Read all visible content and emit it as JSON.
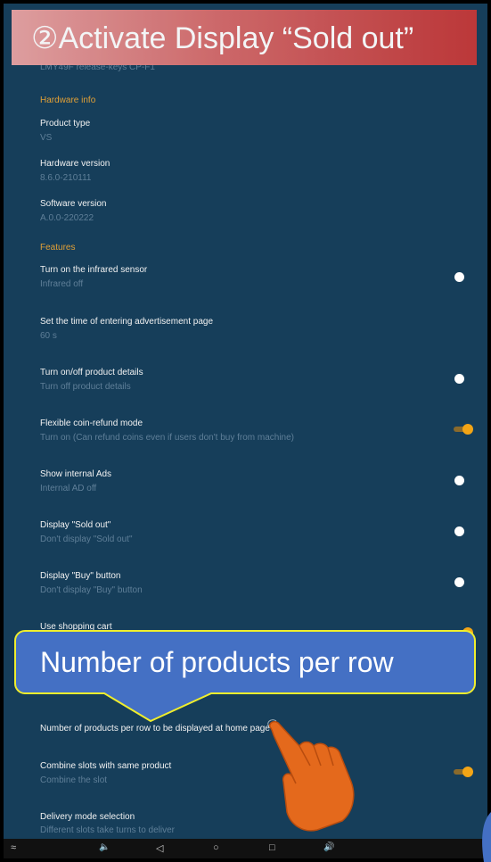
{
  "banner": {
    "title": "②Activate Display “Sold out”"
  },
  "callout": {
    "text": "Number of products per row"
  },
  "settings": {
    "prev_sub": "LMY49F release-keys CP-F1",
    "hardware_section": "Hardware info",
    "product_type": {
      "title": "Product type",
      "value": "VS"
    },
    "hardware_version": {
      "title": "Hardware version",
      "value": "8.6.0-210111"
    },
    "software_version": {
      "title": "Software version",
      "value": "A.0.0-220222"
    },
    "features_section": "Features",
    "items": [
      {
        "title": "Turn on the infrared sensor",
        "sub": "Infrared off",
        "toggle": "off"
      },
      {
        "title": "Set the time of entering advertisement page",
        "sub": "60 s",
        "toggle": "none"
      },
      {
        "title": "Turn on/off product details",
        "sub": "Turn off product details",
        "toggle": "off"
      },
      {
        "title": "Flexible coin-refund mode",
        "sub": "Turn on (Can refund coins even if users don't buy from machine)",
        "toggle": "on"
      },
      {
        "title": "Show internal Ads",
        "sub": "Internal AD off",
        "toggle": "off"
      },
      {
        "title": "Display \"Sold out\"",
        "sub": "Don't display \"Sold out\"",
        "toggle": "off"
      },
      {
        "title": "Display \"Buy\" button",
        "sub": "Don't display \"Buy\" button",
        "toggle": "off"
      },
      {
        "title": "Use shopping cart",
        "sub": "",
        "toggle": "on"
      },
      {
        "title": "Number of products per row to be displayed at home page",
        "sub": "",
        "toggle": "none"
      },
      {
        "title": "Combine slots with same product",
        "sub": "Combine the slot",
        "toggle": "on"
      },
      {
        "title": "Delivery mode selection",
        "sub": "Different slots take turns to deliver",
        "toggle": "none"
      }
    ]
  },
  "navbar": {
    "menu_icon": "≈",
    "vol_down_icon": "🔈",
    "back_icon": "◁",
    "home_icon": "○",
    "recents_icon": "□",
    "vol_up_icon": "🔊"
  },
  "colors": {
    "background": "#163e5a",
    "accent": "#e2a036",
    "toggle_on": "#f3a516"
  }
}
